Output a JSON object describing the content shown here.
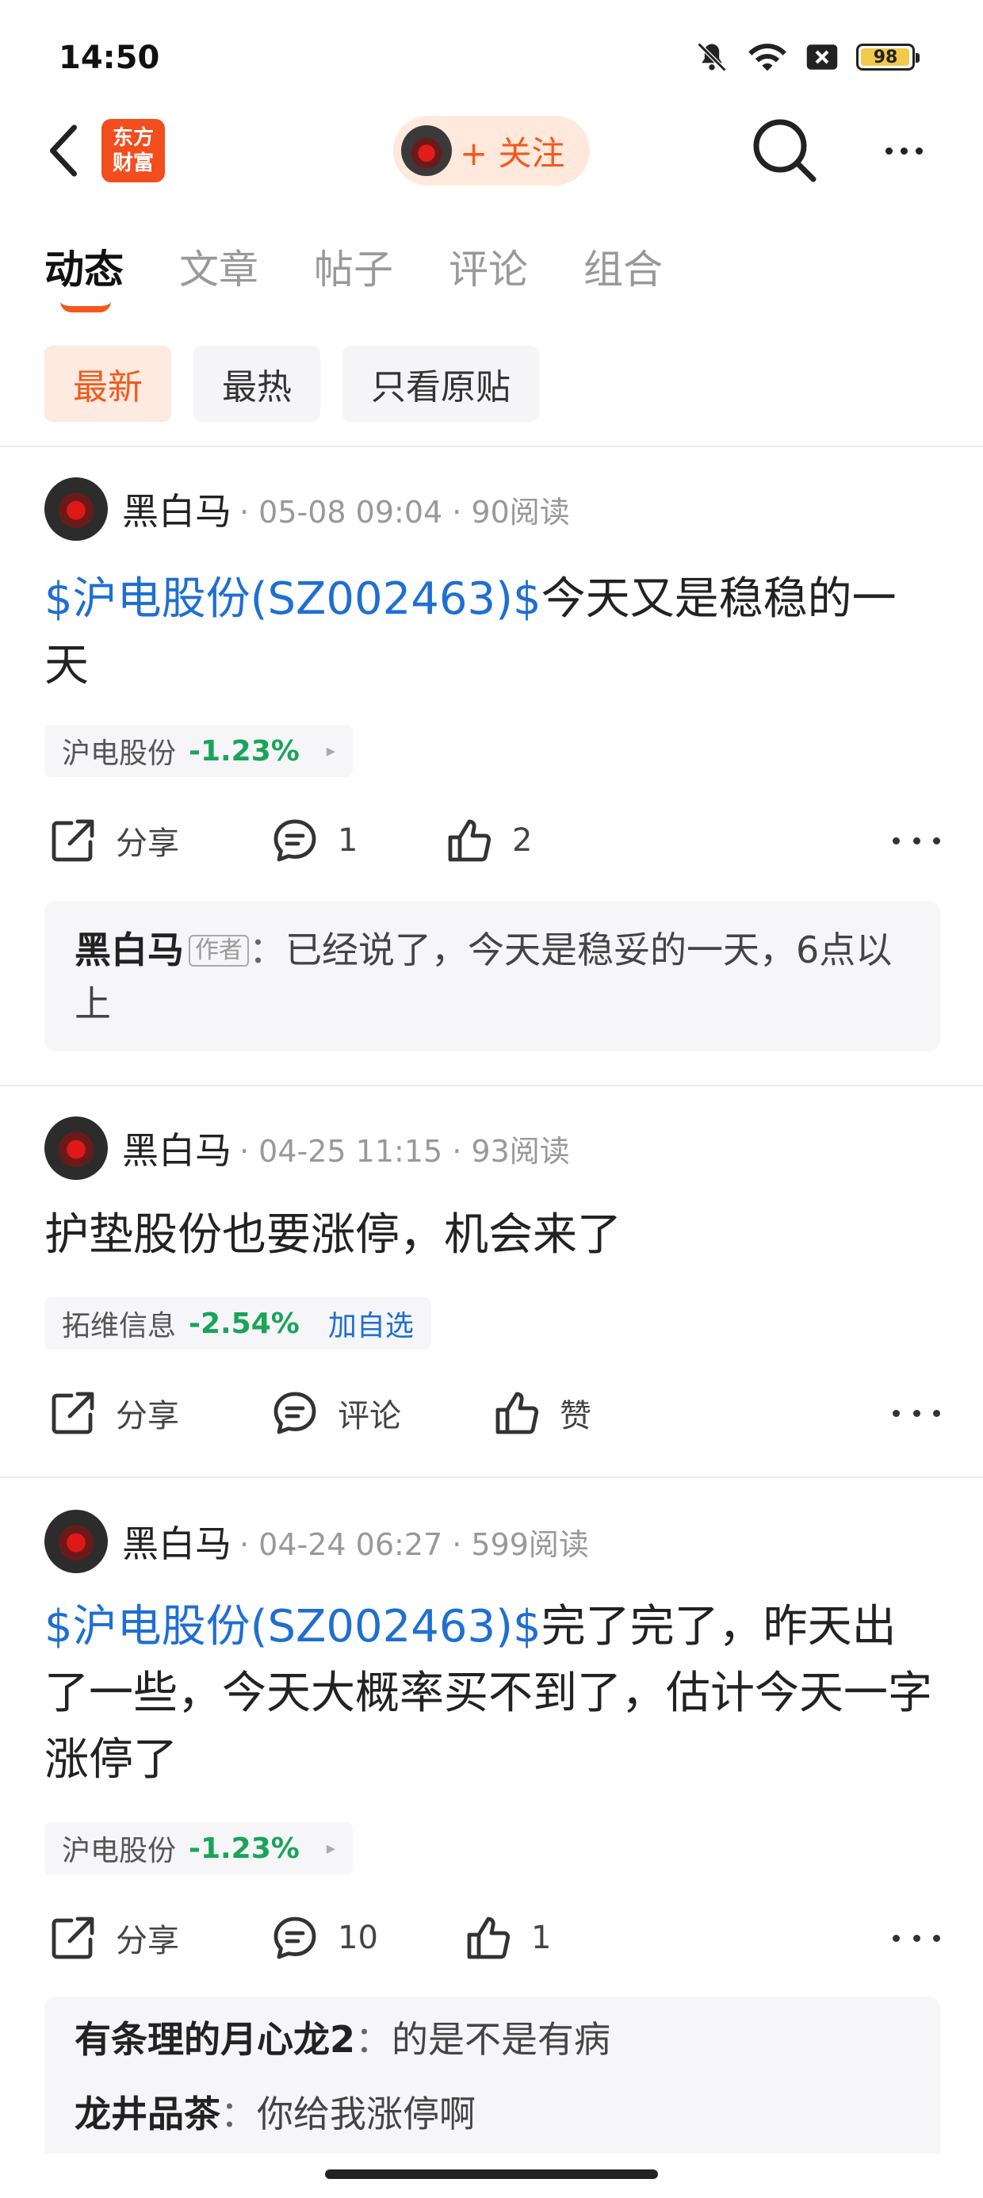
{
  "status_bar": {
    "time": "14:50",
    "battery": "98",
    "battery_level_pct": 98
  },
  "header": {
    "logo_text": "东方财富",
    "follow_label": "+ 关注"
  },
  "tabs": [
    {
      "label": "动态",
      "active": true
    },
    {
      "label": "文章",
      "active": false
    },
    {
      "label": "帖子",
      "active": false
    },
    {
      "label": "评论",
      "active": false
    },
    {
      "label": "组合",
      "active": false
    }
  ],
  "filters": [
    {
      "label": "最新",
      "active": true
    },
    {
      "label": "最热",
      "active": false
    },
    {
      "label": "只看原贴",
      "active": false
    }
  ],
  "posts": [
    {
      "author": "黑白马",
      "meta": "· 05-08 09:04 · 90阅读",
      "stock_link": "$沪电股份(SZ002463)$",
      "text": "今天又是稳稳的一天",
      "tag": {
        "name": "沪电股份",
        "change": "-1.23%",
        "arrow": "▸"
      },
      "actions": {
        "share": "分享",
        "comment": "1",
        "like": "2"
      },
      "comments": [
        {
          "name": "黑白马",
          "badge": "作者",
          "sep": "：",
          "text": "已经说了，今天是稳妥的一天，6点以上"
        }
      ]
    },
    {
      "author": "黑白马",
      "meta": "· 04-25 11:15 · 93阅读",
      "text": "护垫股份也要涨停，机会来了",
      "tag": {
        "name": "拓维信息",
        "change": "-2.54%",
        "add": "加自选"
      },
      "actions": {
        "share": "分享",
        "comment": "评论",
        "like": "赞"
      }
    },
    {
      "author": "黑白马",
      "meta": "· 04-24 06:27 · 599阅读",
      "stock_link": "$沪电股份(SZ002463)$",
      "text": "完了完了，昨天出了一些，今天大概率买不到了，估计今天一字涨停了",
      "tag": {
        "name": "沪电股份",
        "change": "-1.23%",
        "arrow": "▸"
      },
      "actions": {
        "share": "分享",
        "comment": "10",
        "like": "1"
      },
      "comments": [
        {
          "name": "有条理的月心龙2",
          "sep": "：",
          "text": "的是不是有病"
        },
        {
          "name": "龙井品茶",
          "sep": "：",
          "text": "你给我涨停啊"
        }
      ]
    }
  ],
  "colors": {
    "accent": "#f25a1c",
    "link": "#1f6fd1",
    "down": "#1aa45a"
  }
}
